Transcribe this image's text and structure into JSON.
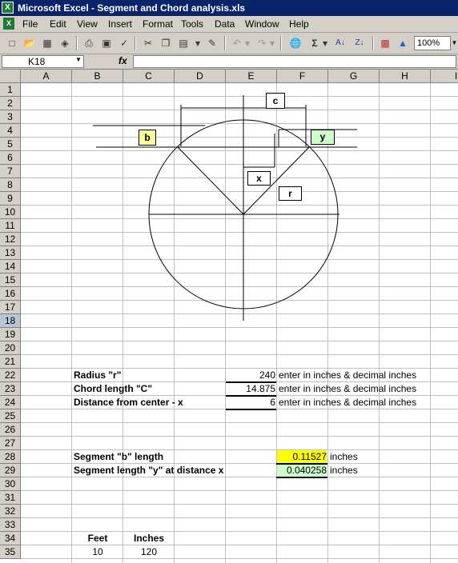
{
  "window": {
    "title": "Microsoft Excel - Segment and Chord analysis.xls"
  },
  "menu": [
    "File",
    "Edit",
    "View",
    "Insert",
    "Format",
    "Tools",
    "Data",
    "Window",
    "Help"
  ],
  "toolbar": {
    "zoom": "100%"
  },
  "formula_bar": {
    "name_box": "K18",
    "fx": "fx",
    "formula": ""
  },
  "columns": [
    "A",
    "B",
    "C",
    "D",
    "E",
    "F",
    "G",
    "H",
    "I"
  ],
  "rows": [
    "1",
    "2",
    "3",
    "4",
    "5",
    "6",
    "7",
    "8",
    "9",
    "10",
    "11",
    "12",
    "13",
    "14",
    "15",
    "16",
    "17",
    "18",
    "19",
    "20",
    "21",
    "22",
    "23",
    "24",
    "25",
    "26",
    "27",
    "28",
    "29",
    "30",
    "31",
    "32",
    "33",
    "34",
    "35"
  ],
  "active_row": "18",
  "diagram": {
    "label_c": "c",
    "label_b": "b",
    "label_y": "y",
    "label_x": "x",
    "label_r": "r",
    "colors": {
      "b_fill": "#ffff99",
      "y_fill": "#ccffcc"
    }
  },
  "inputs": {
    "radius_label": "Radius    \"r\"",
    "radius_value": "240",
    "radius_hint": "enter in inches & decimal inches",
    "chord_label": "Chord length    \"C\"",
    "chord_value": "14.875",
    "chord_hint": "enter in inches & decimal inches",
    "distance_label": "Distance from center - x",
    "distance_value": "6",
    "distance_hint": "enter in inches & decimal inches"
  },
  "results": {
    "segment_b_label": "Segment \"b\" length",
    "segment_b_value": "0.11527",
    "segment_b_unit": "inches",
    "segment_b_color": "#ffff00",
    "segment_y_label": "Segment length \"y\" at distance x",
    "segment_y_value": "0.040258",
    "segment_y_unit": "inches",
    "segment_y_color": "#ccffcc"
  },
  "conversion": {
    "feet_header": "Feet",
    "inches_header": "Inches",
    "feet_value": "10",
    "inches_value": "120"
  }
}
